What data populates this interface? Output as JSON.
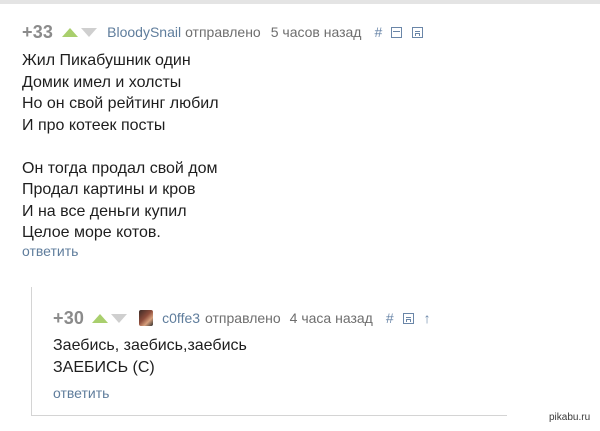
{
  "comment1": {
    "rating": "+33",
    "author": "BloodySnail",
    "sent_label": "отправлено",
    "time": "5 часов назад",
    "hash_icon": "#",
    "lines": [
      "Жил Пикабушник один",
      "Домик имел и холсты",
      "Но он свой рейтинг любил",
      "И про котеек посты",
      "Он тогда продал свой дом",
      "Продал картины и кров",
      "И на все деньги купил",
      "Целое море котов."
    ],
    "reply_label": "ответить"
  },
  "comment2": {
    "rating": "+30",
    "author": "c0ffe3",
    "sent_label": "отправлено",
    "time": "4 часа назад",
    "hash_icon": "#",
    "up_icon": "↑",
    "lines": [
      "Заебись, заебись,заебись",
      "ЗАЕБИСЬ (С)"
    ],
    "reply_label": "ответить"
  },
  "watermark": "pikabu.ru",
  "colors": {
    "upvote": "#a9cf6d",
    "downvote": "#cfcfcf",
    "link": "#5f7d9c",
    "rating": "#8b8b8b"
  }
}
